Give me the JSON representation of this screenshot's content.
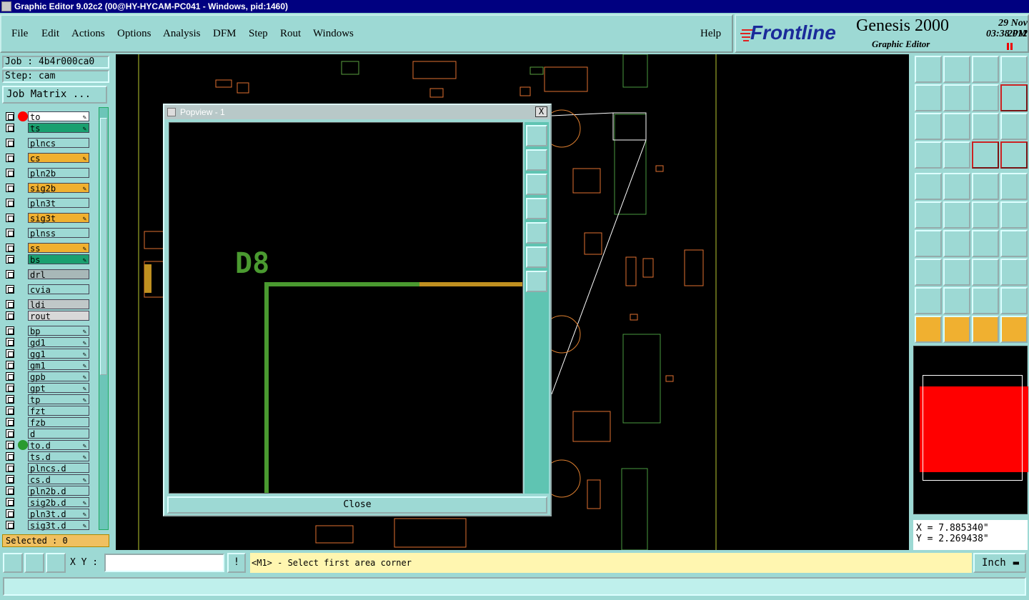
{
  "window": {
    "title": "Graphic Editor 9.02c2 (00@HY-HYCAM-PC041 - Windows, pid:1460)"
  },
  "menu": [
    "File",
    "Edit",
    "Actions",
    "Options",
    "Analysis",
    "DFM",
    "Step",
    "Rout",
    "Windows"
  ],
  "help": "Help",
  "brand": {
    "logo": "Frontline",
    "product": "Genesis 2000",
    "subtitle": "Graphic Editor",
    "date": "29 Nov 2012",
    "time": "03:38 PM"
  },
  "job": {
    "job_label": "Job : 4b4r000ca0",
    "step_label": "Step: cam",
    "matrix_button": "Job Matrix ..."
  },
  "layers": [
    {
      "name": "to",
      "color": "#ffffff",
      "dot": "#ff0000",
      "edit": true
    },
    {
      "name": "ts",
      "color": "#1aa070",
      "edit": true
    },
    {
      "name": "plncs",
      "color": "#9dd9d4"
    },
    {
      "name": "cs",
      "color": "#f0b030",
      "edit": true
    },
    {
      "name": "pln2b",
      "color": "#9dd9d4"
    },
    {
      "name": "sig2b",
      "color": "#f0b030",
      "edit": true
    },
    {
      "name": "pln3t",
      "color": "#9dd9d4"
    },
    {
      "name": "sig3t",
      "color": "#f0b030",
      "edit": true
    },
    {
      "name": "plnss",
      "color": "#9dd9d4"
    },
    {
      "name": "ss",
      "color": "#f0b030",
      "edit": true
    },
    {
      "name": "bs",
      "color": "#1aa070",
      "edit": true
    },
    {
      "name": "drl",
      "color": "#a8b8b8"
    },
    {
      "name": "cvia",
      "color": "#9dd9d4"
    },
    {
      "name": "ldi",
      "color": "#c0c8c8"
    },
    {
      "name": "rout",
      "color": "#d8d8d8"
    },
    {
      "name": "bp",
      "color": "#9dd9d4",
      "edit": true
    },
    {
      "name": "gd1",
      "color": "#9dd9d4",
      "edit": true
    },
    {
      "name": "gg1",
      "color": "#9dd9d4",
      "edit": true
    },
    {
      "name": "gm1",
      "color": "#9dd9d4",
      "edit": true
    },
    {
      "name": "gpb",
      "color": "#9dd9d4",
      "edit": true
    },
    {
      "name": "gpt",
      "color": "#9dd9d4",
      "edit": true
    },
    {
      "name": "tp",
      "color": "#9dd9d4",
      "edit": true
    },
    {
      "name": "fzt",
      "color": "#9dd9d4"
    },
    {
      "name": "fzb",
      "color": "#9dd9d4"
    },
    {
      "name": "d",
      "color": "#9dd9d4"
    },
    {
      "name": "to.d",
      "color": "#9dd9d4",
      "dot": "#2a9a30",
      "edit": true
    },
    {
      "name": "ts.d",
      "color": "#9dd9d4",
      "edit": true
    },
    {
      "name": "plncs.d",
      "color": "#9dd9d4"
    },
    {
      "name": "cs.d",
      "color": "#9dd9d4",
      "edit": true
    },
    {
      "name": "pln2b.d",
      "color": "#9dd9d4"
    },
    {
      "name": "sig2b.d",
      "color": "#9dd9d4",
      "edit": true
    },
    {
      "name": "pln3t.d",
      "color": "#9dd9d4",
      "edit": true
    },
    {
      "name": "sig3t.d",
      "color": "#9dd9d4",
      "edit": true
    }
  ],
  "selected": "Selected : 0",
  "popview": {
    "title": "Popview - 1",
    "close_x": "X",
    "label": "D8",
    "close_button": "Close"
  },
  "coords": {
    "x": "X = 7.885340\"",
    "y": "Y = 2.269438\""
  },
  "bottom": {
    "xy_label": "X Y :",
    "xy_value": "",
    "excl": "!",
    "prompt": "<M1> - Select first area corner",
    "unit": "Inch"
  }
}
